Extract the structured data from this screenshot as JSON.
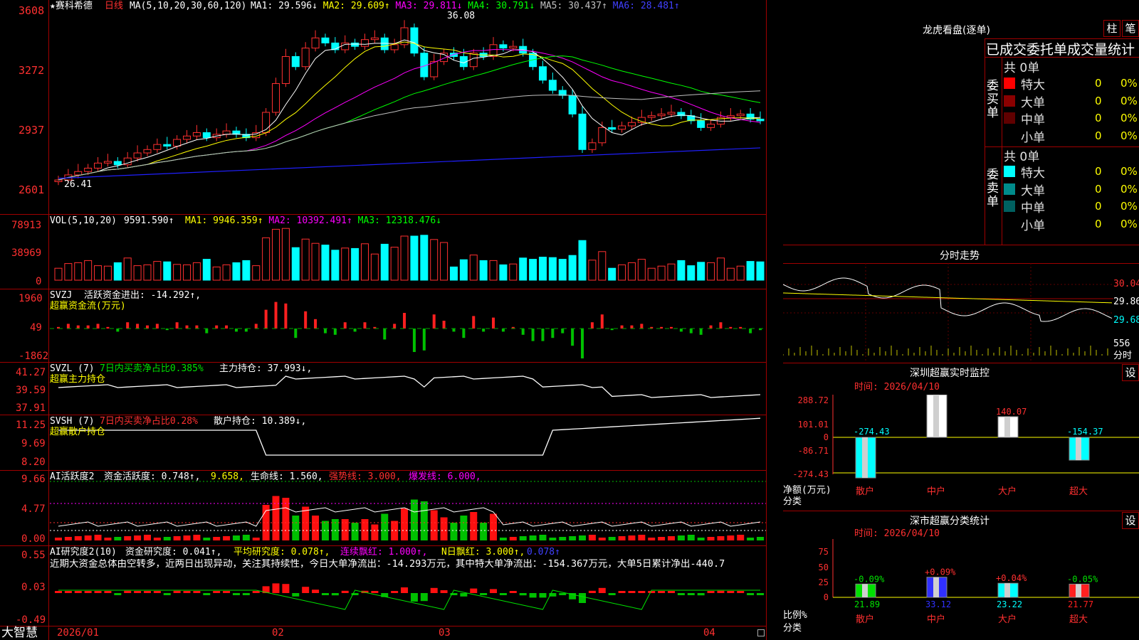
{
  "main": {
    "title": "★赛科希德",
    "period": "日线",
    "ma_label": "MA(5,10,20,30,60,120)",
    "ma_items": [
      {
        "text": "MA1: 29.596↓",
        "color": "#ffffff"
      },
      {
        "text": "MA2: 29.609↑",
        "color": "#ffff00"
      },
      {
        "text": "MA3: 29.811↓",
        "color": "#ff00ff"
      },
      {
        "text": "MA4: 30.791↓",
        "color": "#00ff00"
      },
      {
        "text": "MA5: 30.437↑",
        "color": "#c0c0c0"
      },
      {
        "text": "MA6: 28.481↑",
        "color": "#4040ff"
      }
    ],
    "y_ticks": [
      "3608",
      "3272",
      "2937",
      "2601"
    ],
    "high_label": "36.08",
    "low_label": "26.41"
  },
  "vol": {
    "label": "VOL(5,10,20)",
    "value": "9591.590↑",
    "ma_items": [
      {
        "text": "MA1: 9946.359↑",
        "color": "#ffff00"
      },
      {
        "text": "MA2: 10392.491↑",
        "color": "#ff00ff"
      },
      {
        "text": "MA3: 12318.476↓",
        "color": "#00ff00"
      }
    ],
    "y_ticks": [
      "78913",
      "38969",
      "0"
    ]
  },
  "svzj": {
    "label": "SVZJ",
    "desc": "活跃资金进出: -14.292↑,",
    "sub": "超赢资金流(万元)",
    "y_ticks": [
      "1960",
      "49",
      "-1862"
    ]
  },
  "svzl": {
    "label": "SVZL (7)",
    "desc1": "7日内买卖净占比0.385%",
    "desc2": "主力持仓: 37.993↓,",
    "sub": "超赢主力持仓",
    "y_ticks": [
      "41.27",
      "39.59",
      "37.91"
    ]
  },
  "svsh": {
    "label": "SVSH (7)",
    "desc1": "7日内买卖净占比0.28%",
    "desc2": "散户持仓: 10.389↓,",
    "sub": "超赢散户持仓",
    "y_ticks": [
      "11.25",
      "9.69",
      "8.20"
    ]
  },
  "ai1": {
    "label": "AI活跃度2",
    "desc1": "资金活跃度: 0.748↑,",
    "desc2": "9.658,",
    "desc3": "生命线: 1.560,",
    "desc4": "强势线: 3.000,",
    "desc5": "爆发线: 6.000,",
    "y_ticks": [
      "9.66",
      "4.77",
      "0.00"
    ]
  },
  "ai2": {
    "label": "AI研究度2(10)",
    "desc1": "资金研究度: 0.041↑,",
    "desc2": "平均研究度: 0.078↑,",
    "desc3": "连续飘红: 1.000↑,",
    "desc4": "N日飘红: 3.000↑,",
    "desc5": "0.078↑",
    "note": "近期大资金总体由空转多，近两日出现异动，关注其持续性，今日大单净流出：-14.293万元，其中特大单净流出：-154.367万元，大单5日累计净出-440.7",
    "y_ticks": [
      "0.55",
      "0.03",
      "-0.49"
    ]
  },
  "bottom": {
    "brand": "大智慧",
    "dates": [
      "2026/01",
      "02",
      "03",
      "04"
    ]
  },
  "right": {
    "lh_title": "龙虎看盘(逐单)",
    "btn_bar": "柱",
    "btn_bi": "笔",
    "stats_header": "已成交委托单成交量统计",
    "buy": {
      "side_label": "委买单",
      "total": "共 0单",
      "rows": [
        {
          "name": "特大",
          "color": "#ff0000",
          "count": "0",
          "pct": "0%"
        },
        {
          "name": "大单",
          "color": "#8b0000",
          "count": "0",
          "pct": "0%"
        },
        {
          "name": "中单",
          "color": "#600000",
          "count": "0",
          "pct": "0%"
        },
        {
          "name": "小单",
          "color": "#000000",
          "count": "0",
          "pct": "0%"
        }
      ]
    },
    "sell": {
      "side_label": "委卖单",
      "total": "共 0单",
      "rows": [
        {
          "name": "特大",
          "color": "#00ffff",
          "count": "0",
          "pct": "0%"
        },
        {
          "name": "大单",
          "color": "#008b8b",
          "count": "0",
          "pct": "0%"
        },
        {
          "name": "中单",
          "color": "#006060",
          "count": "0",
          "pct": "0%"
        },
        {
          "name": "小单",
          "color": "#000000",
          "count": "0",
          "pct": "0%"
        }
      ]
    },
    "fs_title": "分时走势",
    "fs_prices": [
      "30.04",
      "29.86",
      "29.68"
    ],
    "fs_vol": "556",
    "fs_unit": "分时",
    "sz_title": "深圳超赢实时监控",
    "sz_btn": "设",
    "sz_time": "时间: 2026/04/10",
    "sz_y": [
      "288.72",
      "101.01",
      "0",
      "-86.71",
      "-274.43"
    ],
    "sz_unit": "净额(万元)",
    "sz_cat_label": "分类",
    "sz_bars": [
      {
        "name": "散户",
        "value": -274.43,
        "label": "-274.43",
        "color": "#00ffff"
      },
      {
        "name": "中户",
        "value": 288.72,
        "label": "288.72",
        "color": "#ffffff"
      },
      {
        "name": "大户",
        "value": 140.07,
        "label": "140.07",
        "color": "#ffffff"
      },
      {
        "name": "超大",
        "value": -154.37,
        "label": "-154.37",
        "color": "#00ffff"
      }
    ],
    "cls_title": "深市超赢分类统计",
    "cls_btn": "设",
    "cls_time": "时间: 2026/04/10",
    "cls_y": [
      "75",
      "50",
      "25",
      "0"
    ],
    "cls_unit": "比例%",
    "cls_cat_label": "分类",
    "cls_bars": [
      {
        "name": "散户",
        "value": 21.89,
        "label": "21.89",
        "change": "-0.09%",
        "color": "#00e000"
      },
      {
        "name": "中户",
        "value": 33.12,
        "label": "33.12",
        "change": "+0.09%",
        "color": "#3030ff"
      },
      {
        "name": "大户",
        "value": 23.22,
        "label": "23.22",
        "change": "+0.04%",
        "color": "#00ffff"
      },
      {
        "name": "超大",
        "value": 21.77,
        "label": "21.77",
        "change": "-0.05%",
        "color": "#ff2020"
      }
    ]
  },
  "colors": {
    "up": "#ff3030",
    "down": "#00ffff",
    "frame": "#a00000"
  }
}
